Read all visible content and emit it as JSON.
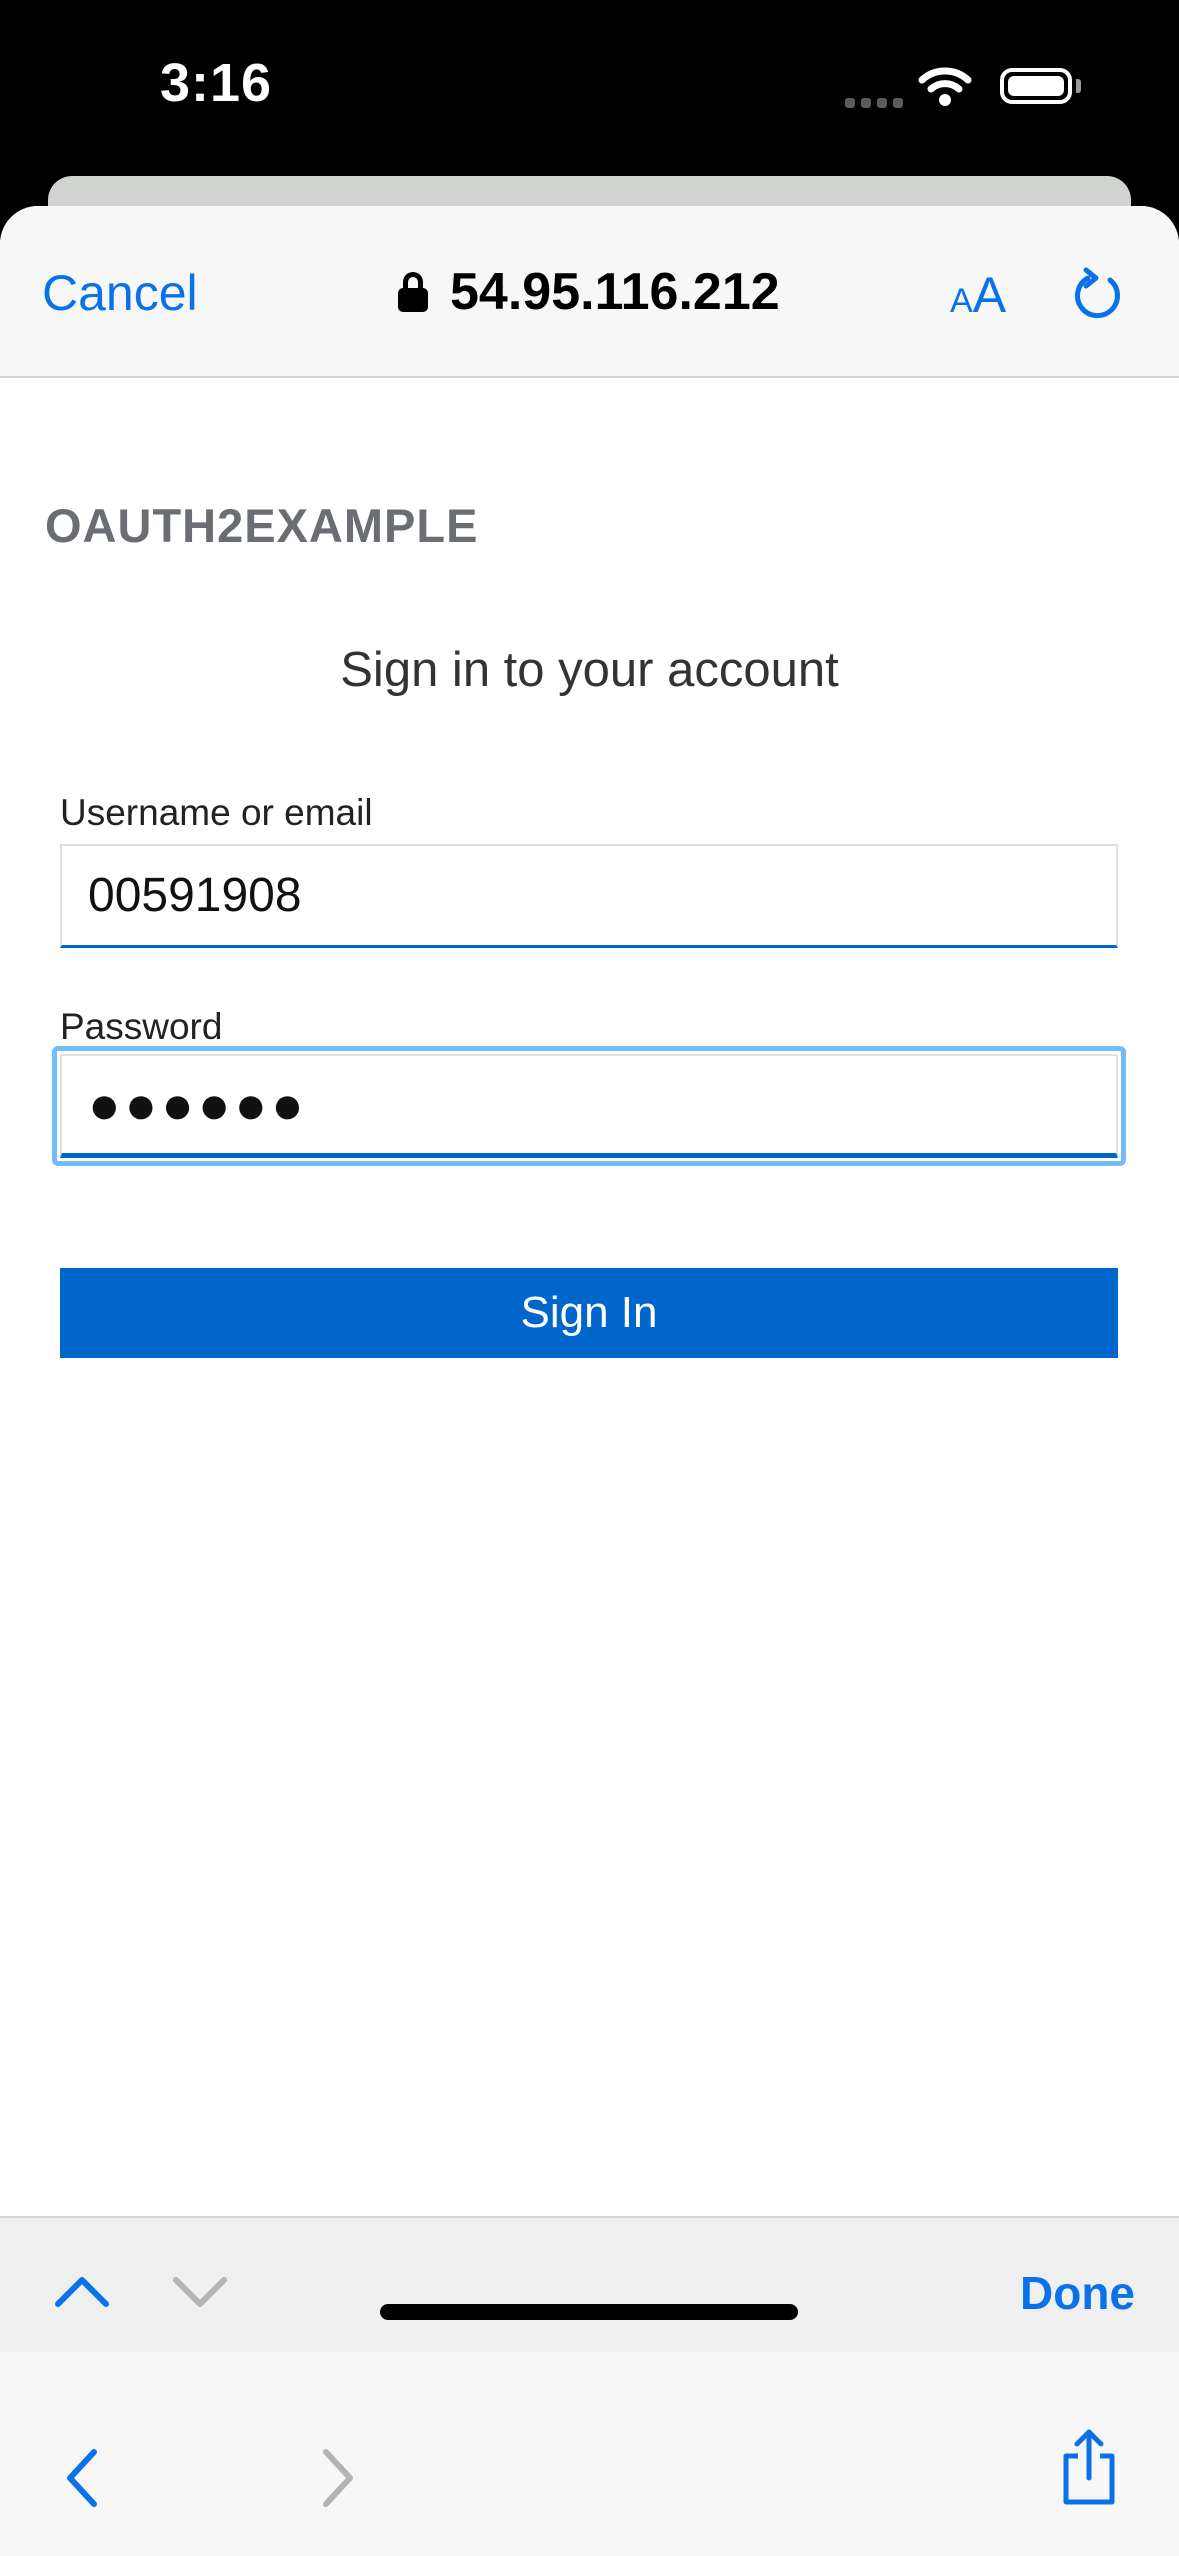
{
  "status_bar": {
    "time": "3:16"
  },
  "browser": {
    "cancel_label": "Cancel",
    "url": "54.95.116.212",
    "text_size_small": "A",
    "text_size_large": "A",
    "done_label": "Done"
  },
  "page": {
    "realm_name": "OAUTH2EXAMPLE",
    "heading": "Sign in to your account",
    "username_label": "Username or email",
    "username_value": "00591908",
    "password_label": "Password",
    "password_value": "●●●●●●",
    "signin_label": "Sign In"
  },
  "colors": {
    "accent": "#0a72e8",
    "button": "#0066cc",
    "focus": "#73bcf7"
  },
  "icons": [
    "lock-icon",
    "text-size-icon",
    "reload-icon",
    "back-icon",
    "forward-icon",
    "share-icon",
    "previous-field-icon",
    "next-field-icon",
    "wifi-icon",
    "battery-icon"
  ]
}
